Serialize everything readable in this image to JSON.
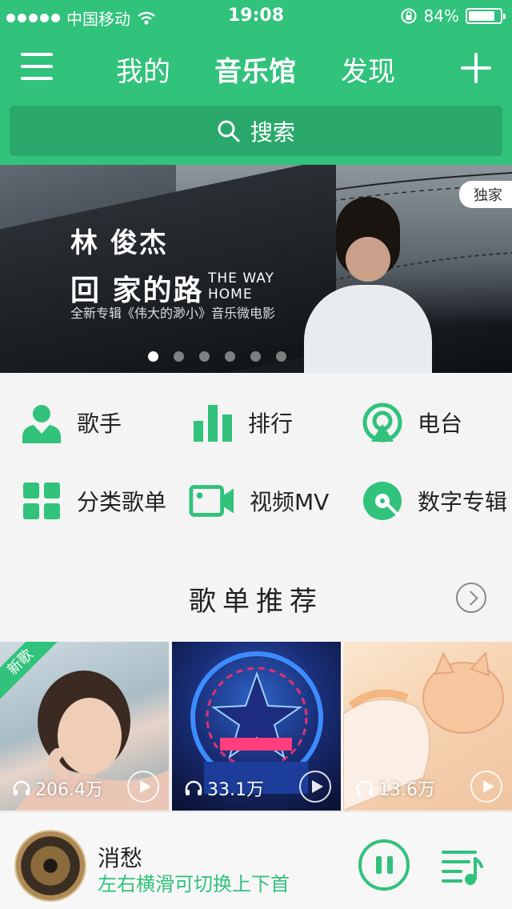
{
  "status_bar": {
    "carrier": "中国移动",
    "time": "19:08",
    "battery": "84%",
    "battery_level": 0.84
  },
  "nav": {
    "tabs": [
      {
        "label": "我的"
      },
      {
        "label": "音乐馆"
      },
      {
        "label": "发现"
      }
    ],
    "active_tab": "音乐馆"
  },
  "search": {
    "placeholder": "搜索"
  },
  "banner": {
    "artist": "林 俊杰",
    "title": "回 家的路",
    "title_en": "THE WAY HOME",
    "subtitle": "全新专辑《伟大的渺小》音乐微电影",
    "badge": "独家",
    "pages": 6,
    "current_page": 1
  },
  "categories": [
    {
      "label": "歌手",
      "icon": "singer-icon"
    },
    {
      "label": "排行",
      "icon": "chart-icon"
    },
    {
      "label": "电台",
      "icon": "radio-icon"
    },
    {
      "label": "分类歌单",
      "icon": "category-icon"
    },
    {
      "label": "视频MV",
      "icon": "video-icon"
    },
    {
      "label": "数字专辑",
      "icon": "album-icon"
    }
  ],
  "section": {
    "title": "歌单推荐"
  },
  "playlists": [
    {
      "count": "206.4万",
      "tag": "新歌"
    },
    {
      "count": "33.1万",
      "tag": ""
    },
    {
      "count": "13.6万",
      "tag": ""
    }
  ],
  "player": {
    "title": "消愁",
    "hint": "左右横滑可切换上下首"
  },
  "colors": {
    "accent": "#31c27c",
    "accent_dark": "#2aa86b"
  }
}
